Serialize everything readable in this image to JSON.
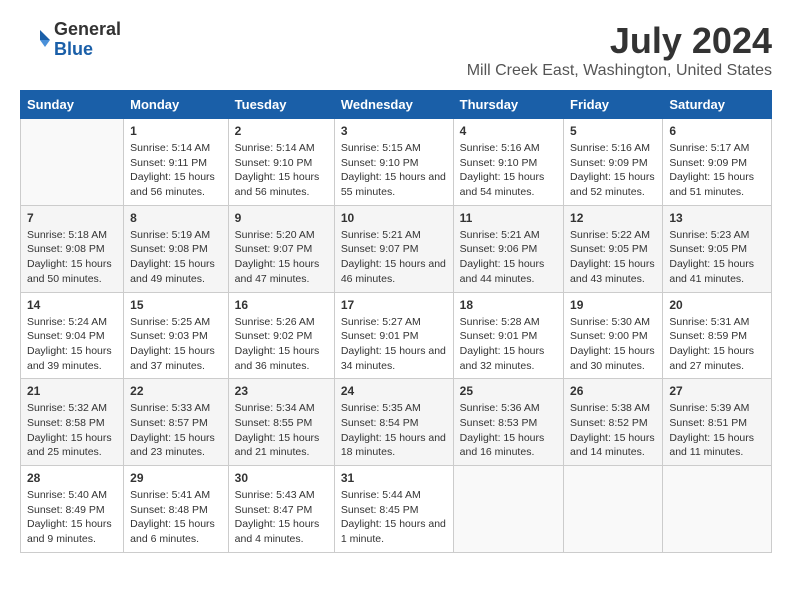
{
  "logo": {
    "general": "General",
    "blue": "Blue"
  },
  "title": "July 2024",
  "subtitle": "Mill Creek East, Washington, United States",
  "days_header": [
    "Sunday",
    "Monday",
    "Tuesday",
    "Wednesday",
    "Thursday",
    "Friday",
    "Saturday"
  ],
  "weeks": [
    [
      {
        "num": "",
        "sunrise": "",
        "sunset": "",
        "daylight": ""
      },
      {
        "num": "1",
        "sunrise": "Sunrise: 5:14 AM",
        "sunset": "Sunset: 9:11 PM",
        "daylight": "Daylight: 15 hours and 56 minutes."
      },
      {
        "num": "2",
        "sunrise": "Sunrise: 5:14 AM",
        "sunset": "Sunset: 9:10 PM",
        "daylight": "Daylight: 15 hours and 56 minutes."
      },
      {
        "num": "3",
        "sunrise": "Sunrise: 5:15 AM",
        "sunset": "Sunset: 9:10 PM",
        "daylight": "Daylight: 15 hours and 55 minutes."
      },
      {
        "num": "4",
        "sunrise": "Sunrise: 5:16 AM",
        "sunset": "Sunset: 9:10 PM",
        "daylight": "Daylight: 15 hours and 54 minutes."
      },
      {
        "num": "5",
        "sunrise": "Sunrise: 5:16 AM",
        "sunset": "Sunset: 9:09 PM",
        "daylight": "Daylight: 15 hours and 52 minutes."
      },
      {
        "num": "6",
        "sunrise": "Sunrise: 5:17 AM",
        "sunset": "Sunset: 9:09 PM",
        "daylight": "Daylight: 15 hours and 51 minutes."
      }
    ],
    [
      {
        "num": "7",
        "sunrise": "Sunrise: 5:18 AM",
        "sunset": "Sunset: 9:08 PM",
        "daylight": "Daylight: 15 hours and 50 minutes."
      },
      {
        "num": "8",
        "sunrise": "Sunrise: 5:19 AM",
        "sunset": "Sunset: 9:08 PM",
        "daylight": "Daylight: 15 hours and 49 minutes."
      },
      {
        "num": "9",
        "sunrise": "Sunrise: 5:20 AM",
        "sunset": "Sunset: 9:07 PM",
        "daylight": "Daylight: 15 hours and 47 minutes."
      },
      {
        "num": "10",
        "sunrise": "Sunrise: 5:21 AM",
        "sunset": "Sunset: 9:07 PM",
        "daylight": "Daylight: 15 hours and 46 minutes."
      },
      {
        "num": "11",
        "sunrise": "Sunrise: 5:21 AM",
        "sunset": "Sunset: 9:06 PM",
        "daylight": "Daylight: 15 hours and 44 minutes."
      },
      {
        "num": "12",
        "sunrise": "Sunrise: 5:22 AM",
        "sunset": "Sunset: 9:05 PM",
        "daylight": "Daylight: 15 hours and 43 minutes."
      },
      {
        "num": "13",
        "sunrise": "Sunrise: 5:23 AM",
        "sunset": "Sunset: 9:05 PM",
        "daylight": "Daylight: 15 hours and 41 minutes."
      }
    ],
    [
      {
        "num": "14",
        "sunrise": "Sunrise: 5:24 AM",
        "sunset": "Sunset: 9:04 PM",
        "daylight": "Daylight: 15 hours and 39 minutes."
      },
      {
        "num": "15",
        "sunrise": "Sunrise: 5:25 AM",
        "sunset": "Sunset: 9:03 PM",
        "daylight": "Daylight: 15 hours and 37 minutes."
      },
      {
        "num": "16",
        "sunrise": "Sunrise: 5:26 AM",
        "sunset": "Sunset: 9:02 PM",
        "daylight": "Daylight: 15 hours and 36 minutes."
      },
      {
        "num": "17",
        "sunrise": "Sunrise: 5:27 AM",
        "sunset": "Sunset: 9:01 PM",
        "daylight": "Daylight: 15 hours and 34 minutes."
      },
      {
        "num": "18",
        "sunrise": "Sunrise: 5:28 AM",
        "sunset": "Sunset: 9:01 PM",
        "daylight": "Daylight: 15 hours and 32 minutes."
      },
      {
        "num": "19",
        "sunrise": "Sunrise: 5:30 AM",
        "sunset": "Sunset: 9:00 PM",
        "daylight": "Daylight: 15 hours and 30 minutes."
      },
      {
        "num": "20",
        "sunrise": "Sunrise: 5:31 AM",
        "sunset": "Sunset: 8:59 PM",
        "daylight": "Daylight: 15 hours and 27 minutes."
      }
    ],
    [
      {
        "num": "21",
        "sunrise": "Sunrise: 5:32 AM",
        "sunset": "Sunset: 8:58 PM",
        "daylight": "Daylight: 15 hours and 25 minutes."
      },
      {
        "num": "22",
        "sunrise": "Sunrise: 5:33 AM",
        "sunset": "Sunset: 8:57 PM",
        "daylight": "Daylight: 15 hours and 23 minutes."
      },
      {
        "num": "23",
        "sunrise": "Sunrise: 5:34 AM",
        "sunset": "Sunset: 8:55 PM",
        "daylight": "Daylight: 15 hours and 21 minutes."
      },
      {
        "num": "24",
        "sunrise": "Sunrise: 5:35 AM",
        "sunset": "Sunset: 8:54 PM",
        "daylight": "Daylight: 15 hours and 18 minutes."
      },
      {
        "num": "25",
        "sunrise": "Sunrise: 5:36 AM",
        "sunset": "Sunset: 8:53 PM",
        "daylight": "Daylight: 15 hours and 16 minutes."
      },
      {
        "num": "26",
        "sunrise": "Sunrise: 5:38 AM",
        "sunset": "Sunset: 8:52 PM",
        "daylight": "Daylight: 15 hours and 14 minutes."
      },
      {
        "num": "27",
        "sunrise": "Sunrise: 5:39 AM",
        "sunset": "Sunset: 8:51 PM",
        "daylight": "Daylight: 15 hours and 11 minutes."
      }
    ],
    [
      {
        "num": "28",
        "sunrise": "Sunrise: 5:40 AM",
        "sunset": "Sunset: 8:49 PM",
        "daylight": "Daylight: 15 hours and 9 minutes."
      },
      {
        "num": "29",
        "sunrise": "Sunrise: 5:41 AM",
        "sunset": "Sunset: 8:48 PM",
        "daylight": "Daylight: 15 hours and 6 minutes."
      },
      {
        "num": "30",
        "sunrise": "Sunrise: 5:43 AM",
        "sunset": "Sunset: 8:47 PM",
        "daylight": "Daylight: 15 hours and 4 minutes."
      },
      {
        "num": "31",
        "sunrise": "Sunrise: 5:44 AM",
        "sunset": "Sunset: 8:45 PM",
        "daylight": "Daylight: 15 hours and 1 minute."
      },
      {
        "num": "",
        "sunrise": "",
        "sunset": "",
        "daylight": ""
      },
      {
        "num": "",
        "sunrise": "",
        "sunset": "",
        "daylight": ""
      },
      {
        "num": "",
        "sunrise": "",
        "sunset": "",
        "daylight": ""
      }
    ]
  ]
}
